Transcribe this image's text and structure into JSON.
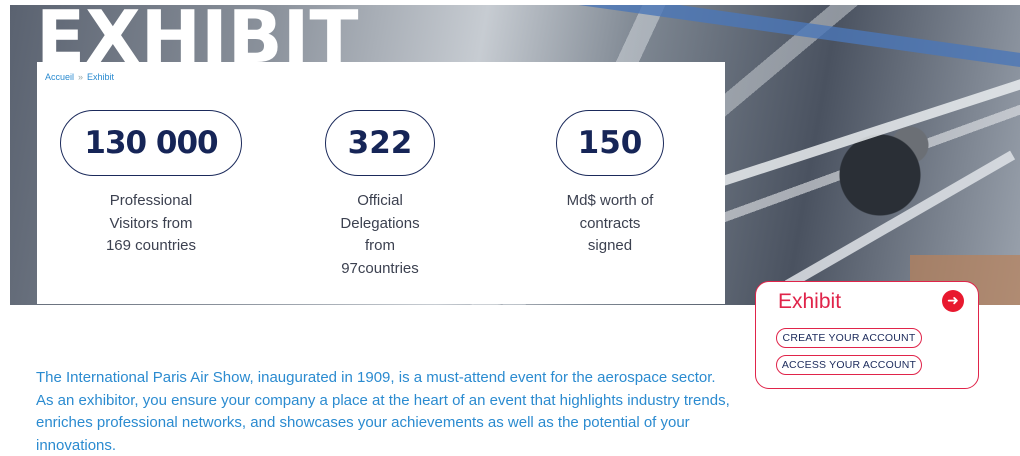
{
  "hero": {
    "title": "EXHIBIT"
  },
  "breadcrumb": {
    "home": "Accueil",
    "separator": "»",
    "current": "Exhibit"
  },
  "stats": [
    {
      "value": "130 000",
      "description_lines": [
        "Professional",
        "Visitors from",
        "169 countries"
      ]
    },
    {
      "value": "322",
      "description_lines": [
        "Official",
        "Delegations",
        "from",
        "97countries"
      ]
    },
    {
      "value": "150",
      "description_lines": [
        "Md$ worth of",
        "contracts",
        "signed"
      ]
    }
  ],
  "action_box": {
    "title": "Exhibit",
    "arrow_icon": "arrow-right-circle-icon",
    "create_account": "CREATE YOUR ACCOUNT",
    "access_account": "ACCESS YOUR ACCOUNT"
  },
  "intro_text": "The International Paris Air Show, inaugurated in 1909, is a must-attend event for the aerospace sector. As an exhibitor, you ensure your company a place at the heart of an event that highlights industry trends, enriches professional networks, and showcases your achievements as well as the potential of your innovations.",
  "colors": {
    "navy": "#1b2a5b",
    "accent_red": "#e0244a",
    "link_blue": "#2b8bd0"
  }
}
